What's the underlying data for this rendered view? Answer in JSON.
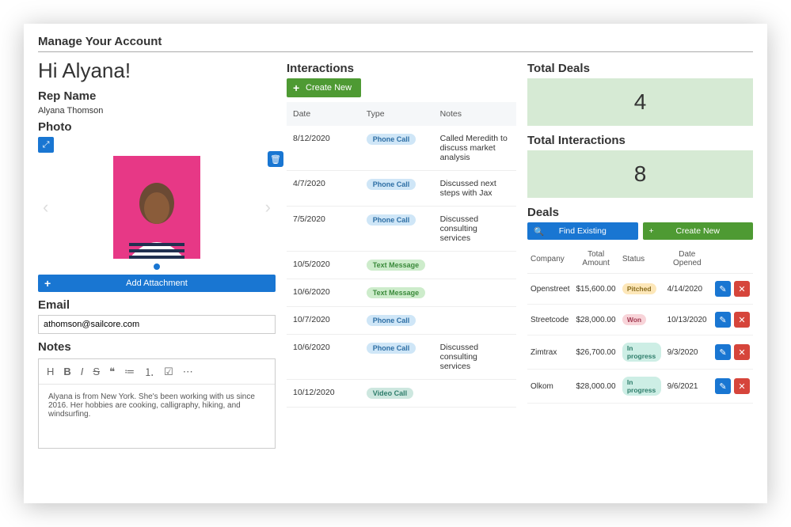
{
  "page_title": "Manage Your Account",
  "greeting": "Hi Alyana!",
  "left": {
    "rep_label": "Rep Name",
    "rep_name": "Alyana Thomson",
    "photo_label": "Photo",
    "add_attachment": "Add Attachment",
    "email_label": "Email",
    "email_value": "athomson@sailcore.com",
    "notes_label": "Notes",
    "notes_body": "Alyana is from New York. She's been working with us since 2016. Her hobbies are cooking, calligraphy, hiking, and windsurfing."
  },
  "interactions": {
    "title": "Interactions",
    "create_label": "Create New",
    "columns": {
      "date": "Date",
      "type": "Type",
      "notes": "Notes"
    },
    "rows": [
      {
        "date": "8/12/2020",
        "type": "Phone Call",
        "type_class": "phone",
        "notes": "Called Meredith to discuss market analysis"
      },
      {
        "date": "4/7/2020",
        "type": "Phone Call",
        "type_class": "phone",
        "notes": "Discussed next steps with Jax"
      },
      {
        "date": "7/5/2020",
        "type": "Phone Call",
        "type_class": "phone",
        "notes": "Discussed consulting services"
      },
      {
        "date": "10/5/2020",
        "type": "Text Message",
        "type_class": "text",
        "notes": ""
      },
      {
        "date": "10/6/2020",
        "type": "Text Message",
        "type_class": "text",
        "notes": ""
      },
      {
        "date": "10/7/2020",
        "type": "Phone Call",
        "type_class": "phone",
        "notes": ""
      },
      {
        "date": "10/6/2020",
        "type": "Phone Call",
        "type_class": "phone",
        "notes": "Discussed consulting services"
      },
      {
        "date": "10/12/2020",
        "type": "Video Call",
        "type_class": "video",
        "notes": ""
      }
    ]
  },
  "metrics": {
    "deals_label": "Total Deals",
    "deals_value": "4",
    "inter_label": "Total Interactions",
    "inter_value": "8"
  },
  "deals": {
    "title": "Deals",
    "find_label": "Find Existing",
    "create_label": "Create New",
    "columns": {
      "company": "Company",
      "amount": "Total Amount",
      "status": "Status",
      "date": "Date Opened"
    },
    "rows": [
      {
        "company": "Openstreet",
        "amount": "$15,600.00",
        "status": "Pitched",
        "status_class": "pitched",
        "date": "4/14/2020"
      },
      {
        "company": "Streetcode",
        "amount": "$28,000.00",
        "status": "Won",
        "status_class": "won",
        "date": "10/13/2020"
      },
      {
        "company": "Zimtrax",
        "amount": "$26,700.00",
        "status": "In progress",
        "status_class": "prog",
        "date": "9/3/2020"
      },
      {
        "company": "Olkom",
        "amount": "$28,000.00",
        "status": "In progress",
        "status_class": "prog",
        "date": "9/6/2021"
      }
    ]
  }
}
